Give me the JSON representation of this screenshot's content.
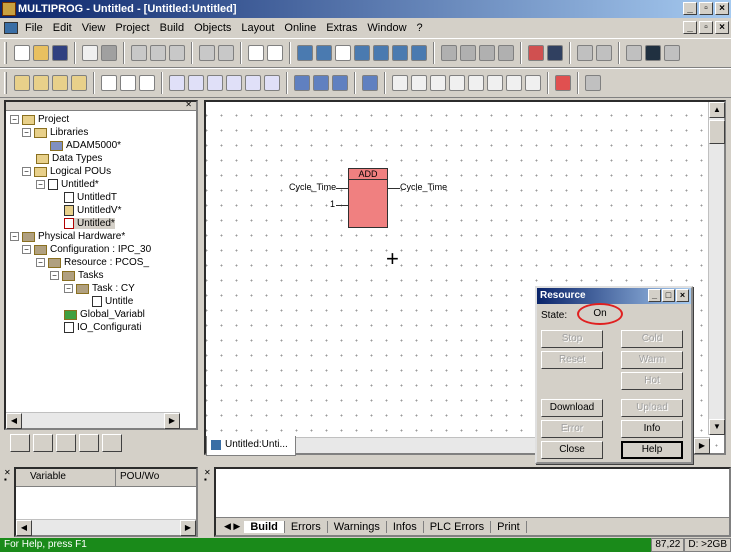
{
  "app": {
    "title": "MULTIPROG - Untitled - [Untitled:Untitled]"
  },
  "menu": [
    "File",
    "Edit",
    "View",
    "Project",
    "Build",
    "Objects",
    "Layout",
    "Online",
    "Extras",
    "Window",
    "?"
  ],
  "tree": {
    "project": "Project",
    "libraries": "Libraries",
    "adam": "ADAM5000*",
    "datatypes": "Data Types",
    "logical": "Logical POUs",
    "untitled": "Untitled*",
    "untitledT": "UntitledT",
    "untitledV": "UntitledV*",
    "untitledStar": "Untitled*",
    "physical": "Physical Hardware*",
    "config": "Configuration : IPC_30",
    "resource": "Resource : PCOS_",
    "tasks": "Tasks",
    "task": "Task : CY",
    "untitleTask": "Untitle",
    "globalvars": "Global_Variabl",
    "ioconfig": "IO_Configurati"
  },
  "editor": {
    "block_name": "ADD",
    "in1": "Cycle_Time",
    "in2": "1",
    "out": "Cycle_Time",
    "tab": "Untitled:Unti..."
  },
  "resource": {
    "title": "Resource",
    "state_label": "State:",
    "state_value": "On",
    "stop": "Stop",
    "cold": "Cold",
    "reset": "Reset",
    "warm": "Warm",
    "hot": "Hot",
    "download": "Download",
    "upload": "Upload",
    "error": "Error",
    "info": "Info",
    "close": "Close",
    "help": "Help"
  },
  "vars": {
    "col1": "Variable",
    "col2": "POU/Wo"
  },
  "output_tabs": [
    "Build",
    "Errors",
    "Warnings",
    "Infos",
    "PLC Errors",
    "Print"
  ],
  "status": {
    "help": "For Help, press F1",
    "pos": "87,22",
    "disk": "D: >2GB"
  }
}
